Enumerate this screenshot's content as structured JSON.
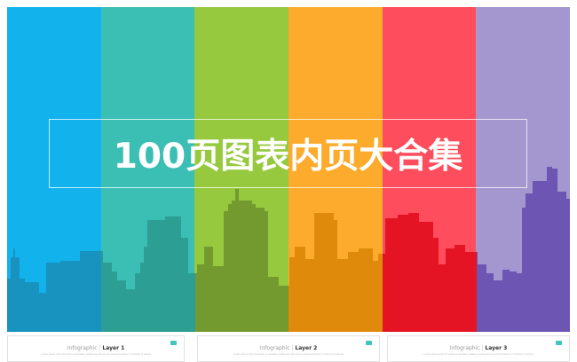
{
  "banner": {
    "title": "100页图表内页大合集",
    "stripe_colors": [
      "#12b2ec",
      "#3bbfb4",
      "#97c93e",
      "#fdab2c",
      "#fe4d5c",
      "#a496cf"
    ],
    "skyline_colors": [
      "#1893c0",
      "#2c9e94",
      "#739a2e",
      "#e08a0c",
      "#e41424",
      "#6d55b4"
    ]
  },
  "cards": [
    {
      "prefix": "Infographic",
      "name": "Layer 1",
      "subtitle": "Lorem ipsum dolor sit amet consectetur adipiscing elit sed do eiusmod tempor incididunt ut labore"
    },
    {
      "prefix": "Infographic",
      "name": "Layer 2",
      "subtitle": "Lorem ipsum dolor sit amet consectetur adipiscing elit sed do eiusmod tempor incididunt ut labore"
    },
    {
      "prefix": "Infographic",
      "name": "Layer 3",
      "subtitle": "Lorem ipsum dolor sit amet consectetur adipiscing elit sed do eiusmod tempor incididunt ut labore"
    }
  ]
}
